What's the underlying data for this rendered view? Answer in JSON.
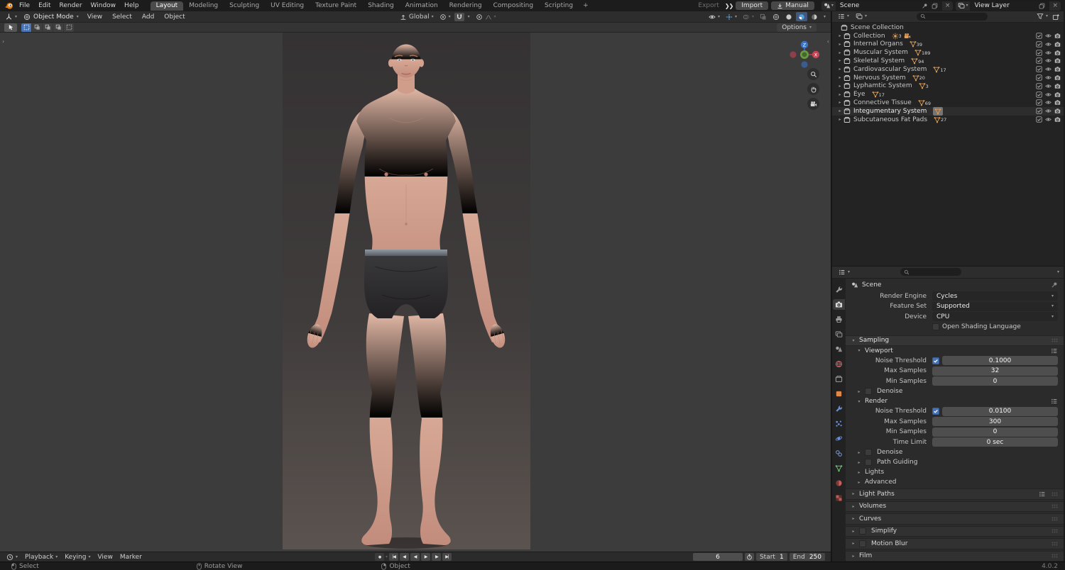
{
  "icons": {
    "disclosure_open": "▾",
    "disclosure_closed": "▸",
    "chevron": "▾",
    "close": "×",
    "plus": "+",
    "toolbar_expand": "›",
    "sidebar_collapse": "‹",
    "ffwd": "❯❯",
    "jump_start": "|◀",
    "key_prev": "◀·",
    "play_back": "◀",
    "play": "▶",
    "key_next": "·▶",
    "jump_end": "▶|",
    "record_dot": "●"
  },
  "topbar": {
    "menus": [
      "File",
      "Edit",
      "Render",
      "Window",
      "Help"
    ],
    "workspaces": [
      "Layout",
      "Modeling",
      "Sculpting",
      "UV Editing",
      "Texture Paint",
      "Shading",
      "Animation",
      "Rendering",
      "Compositing",
      "Scripting"
    ],
    "export": "Export",
    "import": "Import",
    "manual": "Manual",
    "scene": "Scene",
    "view_layer": "View Layer"
  },
  "viewport": {
    "mode": "Object Mode",
    "menus": [
      "View",
      "Select",
      "Add",
      "Object"
    ],
    "orientation": "Global",
    "options": "Options",
    "gizmo_z": "Z",
    "gizmo_x": "X"
  },
  "outliner": {
    "root": "Scene Collection",
    "rows": [
      {
        "label": "Collection",
        "light_count": "3"
      },
      {
        "label": "Internal Organs",
        "count": "39"
      },
      {
        "label": "Muscular System",
        "count": "189"
      },
      {
        "label": "Skeletal System",
        "count": "94"
      },
      {
        "label": "Cardiovascular System",
        "count": "17"
      },
      {
        "label": "Nervous System",
        "count": "20"
      },
      {
        "label": "Lyphamtic System",
        "count": "3"
      },
      {
        "label": "Eye",
        "count": "17"
      },
      {
        "label": "Connective Tissue",
        "count": "69"
      },
      {
        "label": "Integumentary System"
      },
      {
        "label": "Subcutaneous Fat Pads",
        "count": "27"
      }
    ]
  },
  "properties": {
    "breadcrumb": "Scene",
    "render_engine_label": "Render Engine",
    "render_engine": "Cycles",
    "feature_set_label": "Feature Set",
    "feature_set": "Supported",
    "device_label": "Device",
    "device": "CPU",
    "osl": "Open Shading Language",
    "sampling": {
      "title": "Sampling",
      "viewport_title": "Viewport",
      "render_title": "Render",
      "noise_threshold_label": "Noise Threshold",
      "viewport_noise_threshold": "0.1000",
      "max_samples_label": "Max Samples",
      "viewport_max_samples": "32",
      "min_samples_label": "Min Samples",
      "viewport_min_samples": "0",
      "denoise_label": "Denoise",
      "render_noise_threshold": "0.0100",
      "render_max_samples": "300",
      "render_min_samples": "0",
      "time_limit_label": "Time Limit",
      "time_limit": "0 sec",
      "path_guiding": "Path Guiding",
      "lights": "Lights",
      "advanced": "Advanced"
    },
    "panels": [
      "Light Paths",
      "Volumes",
      "Curves",
      "Simplify",
      "Motion Blur",
      "Film"
    ]
  },
  "timeline": {
    "menus": [
      "Playback",
      "Keying",
      "View",
      "Marker"
    ],
    "current_frame": "6",
    "start_label": "Start",
    "start": "1",
    "end_label": "End",
    "end": "250"
  },
  "statusbar": {
    "left": "Select",
    "middle": "Rotate View",
    "right": "Object",
    "version": "4.0.2"
  }
}
